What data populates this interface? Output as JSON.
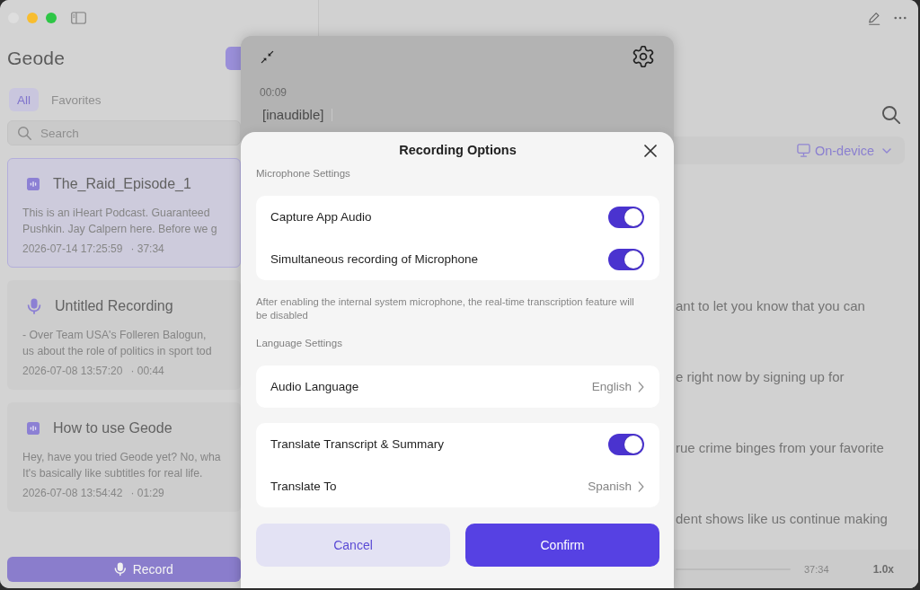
{
  "sidebar": {
    "app_name": "Geode",
    "tabs": [
      {
        "label": "All",
        "selected": true
      },
      {
        "label": "Favorites",
        "selected": false
      }
    ],
    "search": {
      "placeholder": "Search"
    },
    "recordings": [
      {
        "kind": "file",
        "title": "The_Raid_Episode_1",
        "snippet_lines": [
          "This is an iHeart Podcast. Guaranteed",
          "Pushkin. Jay Calpern here. Before we g"
        ],
        "date": "2026-07-14 17:25:59",
        "duration": "· 37:34",
        "selected": true
      },
      {
        "kind": "recording",
        "title": "Untitled Recording",
        "snippet_lines": [
          "- Over Team USA's Folleren Balogun,",
          "us about the role of politics in sport tod"
        ],
        "date": "2026-07-08 13:57:20",
        "duration": "· 00:44",
        "selected": false
      },
      {
        "kind": "file",
        "title": "How to use Geode",
        "snippet_lines": [
          "Hey, have you tried Geode yet? No, wha",
          "It's basically like subtitles for real life."
        ],
        "date": "2026-07-08 13:54:42",
        "duration": "· 01:29",
        "selected": false
      }
    ],
    "record_button": {
      "label": "Record"
    }
  },
  "main": {
    "transcription_mode": "On-device",
    "transcript_lines": [
      "ant to let you know that you can",
      "e right now by signing up for",
      "rue crime binges from your favorite",
      "dent shows like us continue making"
    ],
    "player": {
      "duration": "37:34",
      "speed": "1.0x"
    }
  },
  "recorder": {
    "elapsed": "00:09",
    "live_text": "[inaudible]"
  },
  "dialog": {
    "title": "Recording Options",
    "sections": [
      {
        "heading": "Microphone Settings",
        "groups": [
          {
            "rows": [
              {
                "kind": "toggle",
                "label": "Capture App Audio",
                "on": true
              },
              {
                "kind": "toggle",
                "label": "Simultaneous recording of Microphone",
                "on": true
              }
            ]
          }
        ],
        "note": "After enabling the internal system microphone, the real-time transcription feature will be disabled"
      },
      {
        "heading": "Language Settings",
        "groups": [
          {
            "rows": [
              {
                "kind": "select",
                "label": "Audio Language",
                "value": "English"
              }
            ]
          },
          {
            "rows": [
              {
                "kind": "toggle",
                "label": "Translate Transcript & Summary",
                "on": true
              },
              {
                "kind": "select",
                "label": "Translate To",
                "value": "Spanish"
              }
            ]
          }
        ]
      }
    ],
    "buttons": [
      {
        "kind": "secondary",
        "label": "Cancel"
      },
      {
        "kind": "primary",
        "label": "Confirm"
      }
    ]
  }
}
